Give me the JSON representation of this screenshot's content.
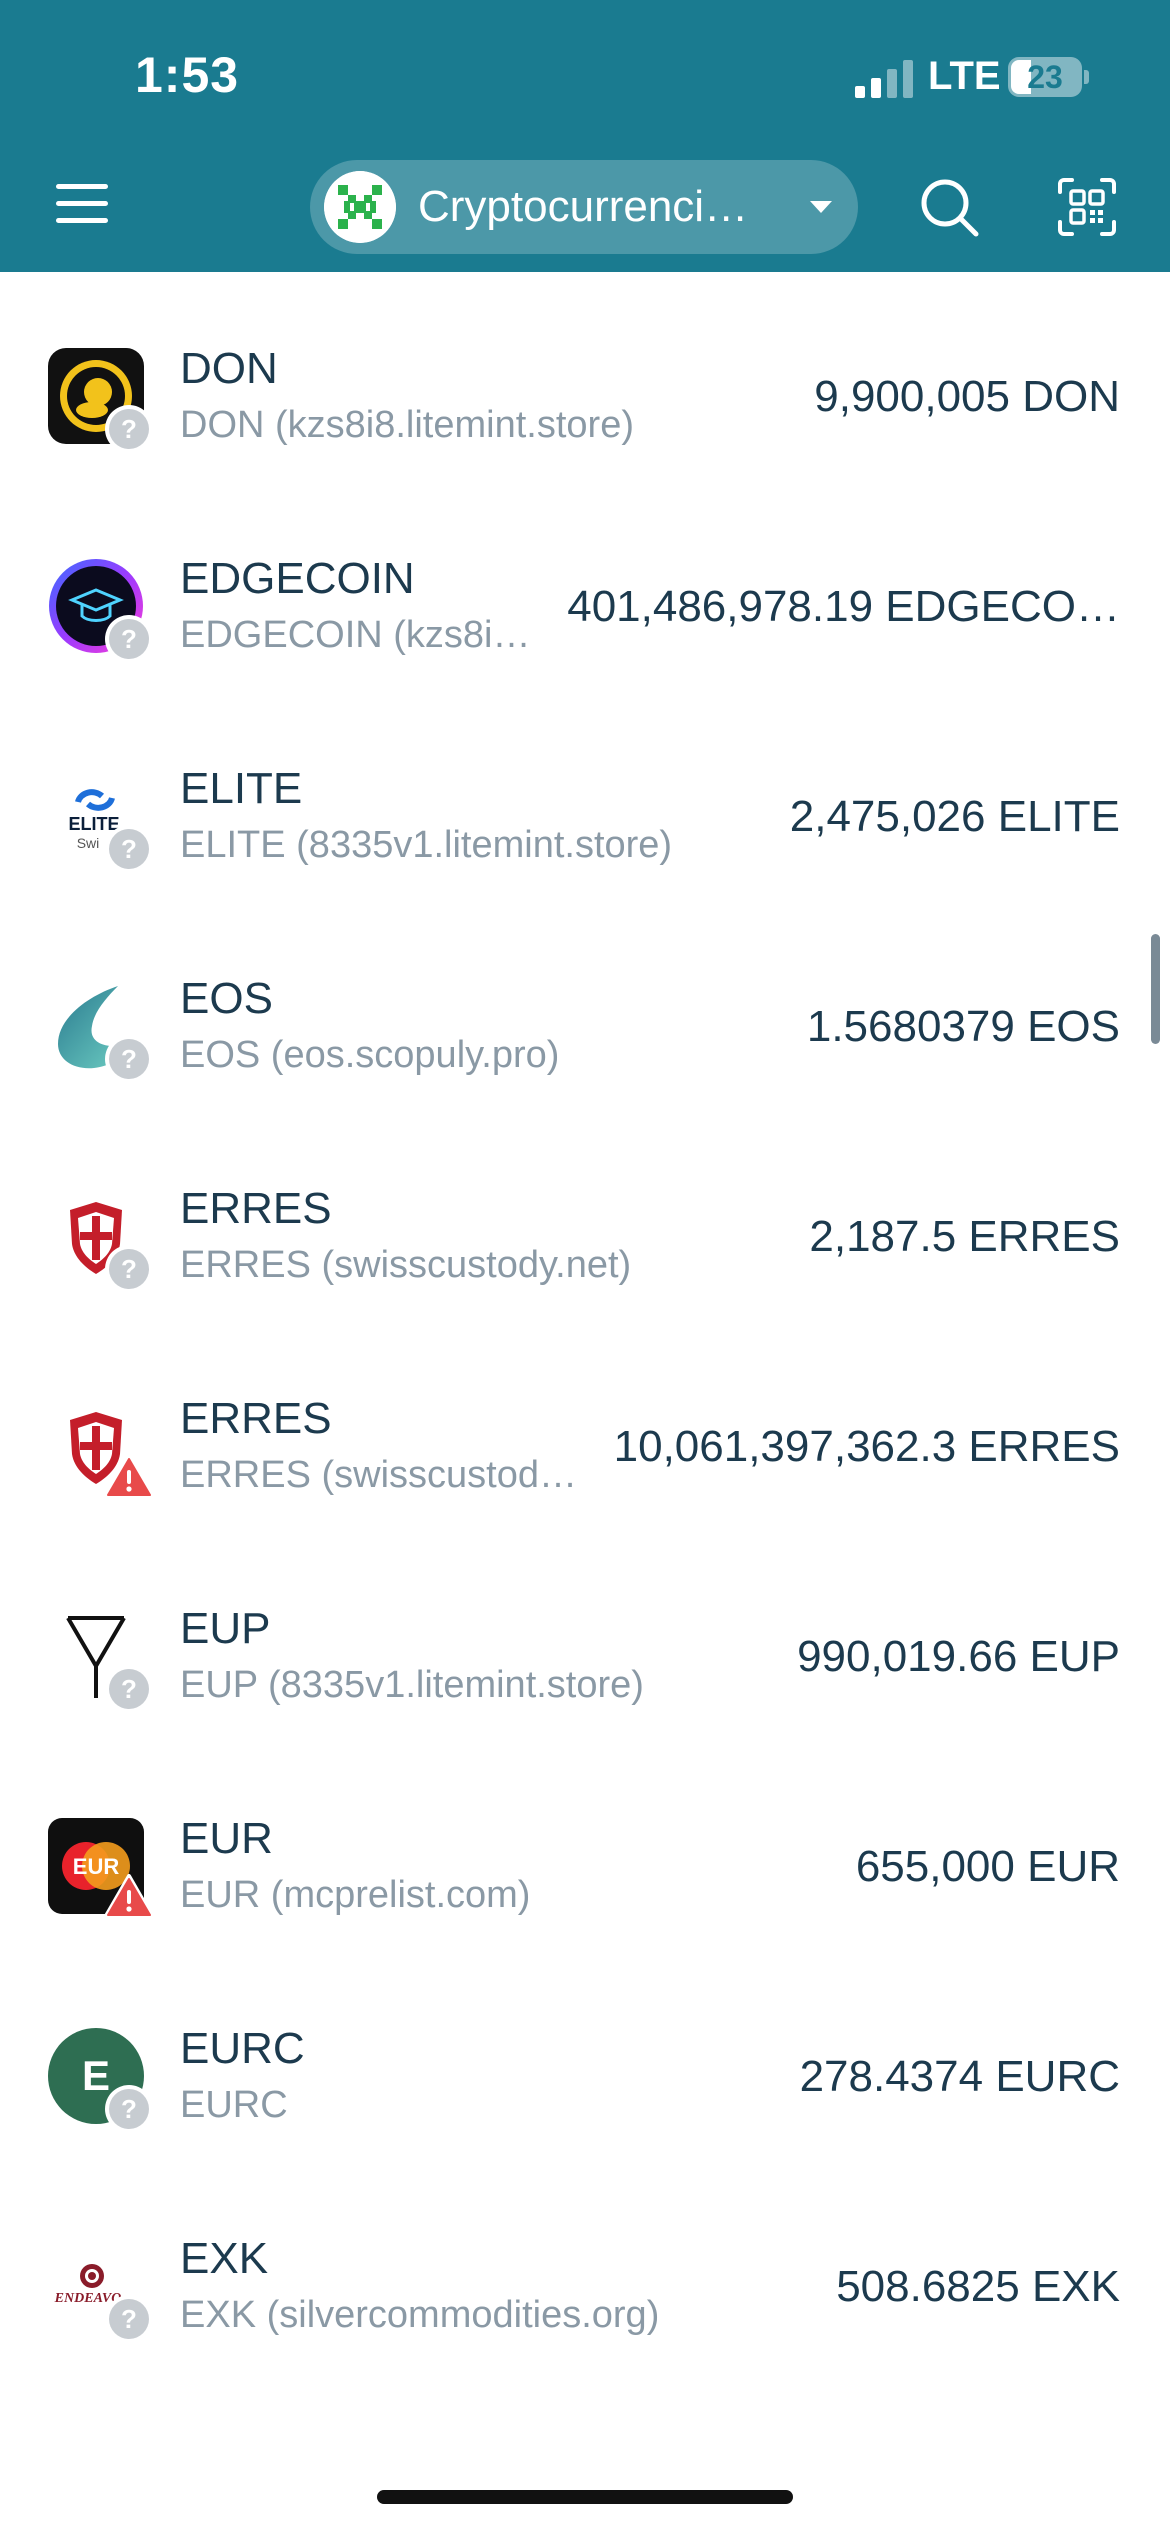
{
  "status_bar": {
    "time": "1:53",
    "network": "LTE",
    "battery": "23"
  },
  "header": {
    "network_name": "Cryptocurrenci…",
    "menu_icon": "hamburger-menu-icon",
    "search_icon": "search-icon",
    "scan_icon": "qr-scan-icon"
  },
  "tokens": [
    {
      "name": "DON",
      "subtitle": "DON (kzs8i8.litemint.store)",
      "balance": "9,900,005 DON",
      "badge": "unknown"
    },
    {
      "name": "EDGECOIN",
      "subtitle": "EDGECOIN (kzs8i…",
      "balance": "401,486,978.19 EDGECO…",
      "badge": "unknown"
    },
    {
      "name": "ELITE",
      "subtitle": "ELITE (8335v1.litemint.store)",
      "balance": "2,475,026 ELITE",
      "badge": "unknown"
    },
    {
      "name": "EOS",
      "subtitle": "EOS (eos.scopuly.pro)",
      "balance": "1.5680379 EOS",
      "badge": "unknown"
    },
    {
      "name": "ERRES",
      "subtitle": "ERRES (swisscustody.net)",
      "balance": "2,187.5 ERRES",
      "badge": "unknown"
    },
    {
      "name": "ERRES",
      "subtitle": "ERRES (swisscustody.…",
      "balance": "10,061,397,362.3 ERRES",
      "badge": "warning"
    },
    {
      "name": "EUP",
      "subtitle": "EUP (8335v1.litemint.store)",
      "balance": "990,019.66 EUP",
      "badge": "unknown"
    },
    {
      "name": "EUR",
      "subtitle": "EUR (mcprelist.com)",
      "balance": "655,000 EUR",
      "badge": "warning"
    },
    {
      "name": "EURC",
      "subtitle": "EURC",
      "balance": "278.4374 EURC",
      "badge": "unknown"
    },
    {
      "name": "EXK",
      "subtitle": "EXK (silvercommodities.org)",
      "balance": "508.6825 EXK",
      "badge": "unknown"
    }
  ],
  "icon_text": {
    "elite": "ELITE",
    "elite_small": "Swi",
    "eur": "EUR",
    "eurc": "E",
    "exk": "ENDEAVO"
  },
  "colors": {
    "header": "#1a7b90",
    "primary_text": "#1c3a4e",
    "secondary_text": "#8a99a5",
    "warning": "#e84a4a",
    "unknown_badge": "#c7ccd1"
  }
}
